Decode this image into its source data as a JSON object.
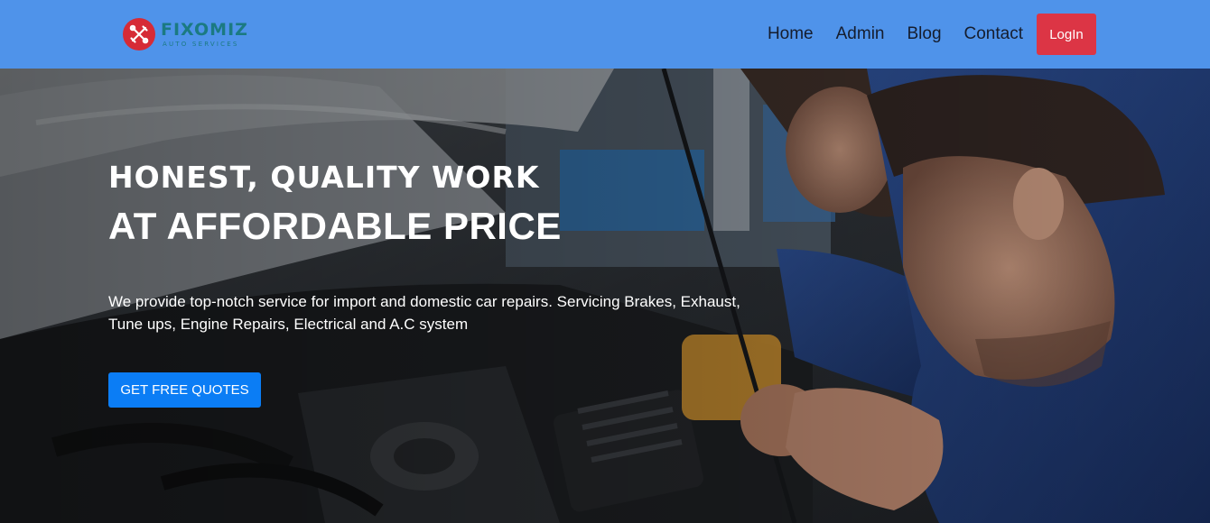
{
  "brand": {
    "name": "FIXOMIZ",
    "tagline": "AUTO SERVICES",
    "logo_icon": "wrench-crossed-icon",
    "accent_color": "#d62b36",
    "text_color": "#1b7a82"
  },
  "nav": {
    "links": [
      {
        "label": "Home"
      },
      {
        "label": "Admin"
      },
      {
        "label": "Blog"
      },
      {
        "label": "Contact"
      }
    ],
    "login_label": "LogIn",
    "bar_color": "#4f93ea",
    "login_color": "#dc3545"
  },
  "hero": {
    "line1": "HONEST, QUALITY WORK",
    "line2": "AT AFFORDABLE PRICE",
    "description": "We provide top-notch service for import and domestic car repairs. Servicing Brakes, Exhaust, Tune ups, Engine Repairs, Electrical and A.C system",
    "cta_label": "GET FREE QUOTES",
    "cta_color": "#0b7df5"
  }
}
